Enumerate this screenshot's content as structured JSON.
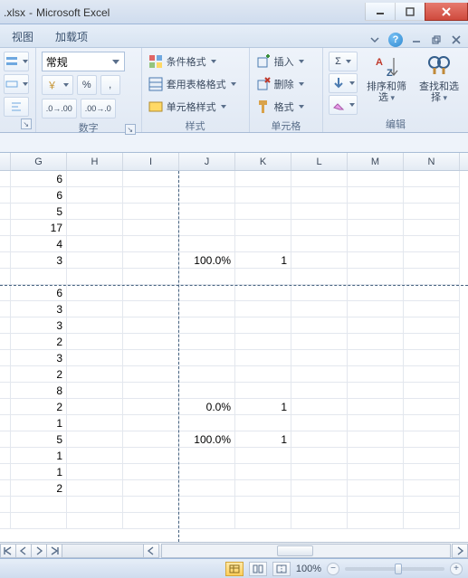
{
  "window": {
    "filename_fragment": ".xlsx",
    "app_name": "Microsoft Excel",
    "separator": " - "
  },
  "tabs": {
    "left1": "视图",
    "left2": "加载项"
  },
  "help": "?",
  "number_group": {
    "label": "数字",
    "format_name": "常规",
    "currency_icon": "货币",
    "percent": "%",
    "comma": ",",
    "inc_dec": ".0",
    "dec_inc": ".00"
  },
  "styles_group": {
    "label": "样式",
    "cond": "条件格式",
    "table": "套用表格格式",
    "cell": "单元格样式"
  },
  "cells_group": {
    "label": "单元格",
    "insert": "插入",
    "delete": "删除",
    "format": "格式"
  },
  "edit_group": {
    "label": "编辑",
    "sum": "Σ",
    "fill": "↧",
    "clear": "⌫",
    "sort": "排序和筛选",
    "find": "查找和选择"
  },
  "chart_data": {
    "type": "table",
    "columns": [
      "G",
      "H",
      "I",
      "J",
      "K",
      "L",
      "M",
      "N"
    ],
    "rows": [
      {
        "G": "6"
      },
      {
        "G": "6"
      },
      {
        "G": "5"
      },
      {
        "G": "17"
      },
      {
        "G": "4"
      },
      {
        "G": "3",
        "J": "100.0%",
        "K": "1"
      },
      {},
      {
        "G": "6"
      },
      {
        "G": "3"
      },
      {
        "G": "3"
      },
      {
        "G": "2"
      },
      {
        "G": "3"
      },
      {
        "G": "2"
      },
      {
        "G": "8"
      },
      {
        "G": "2",
        "J": "0.0%",
        "K": "1"
      },
      {
        "G": "1"
      },
      {
        "G": "5",
        "J": "100.0%",
        "K": "1"
      },
      {
        "G": "1"
      },
      {
        "G": "1"
      },
      {
        "G": "2"
      },
      {},
      {}
    ]
  },
  "status": {
    "zoom": "100%"
  }
}
